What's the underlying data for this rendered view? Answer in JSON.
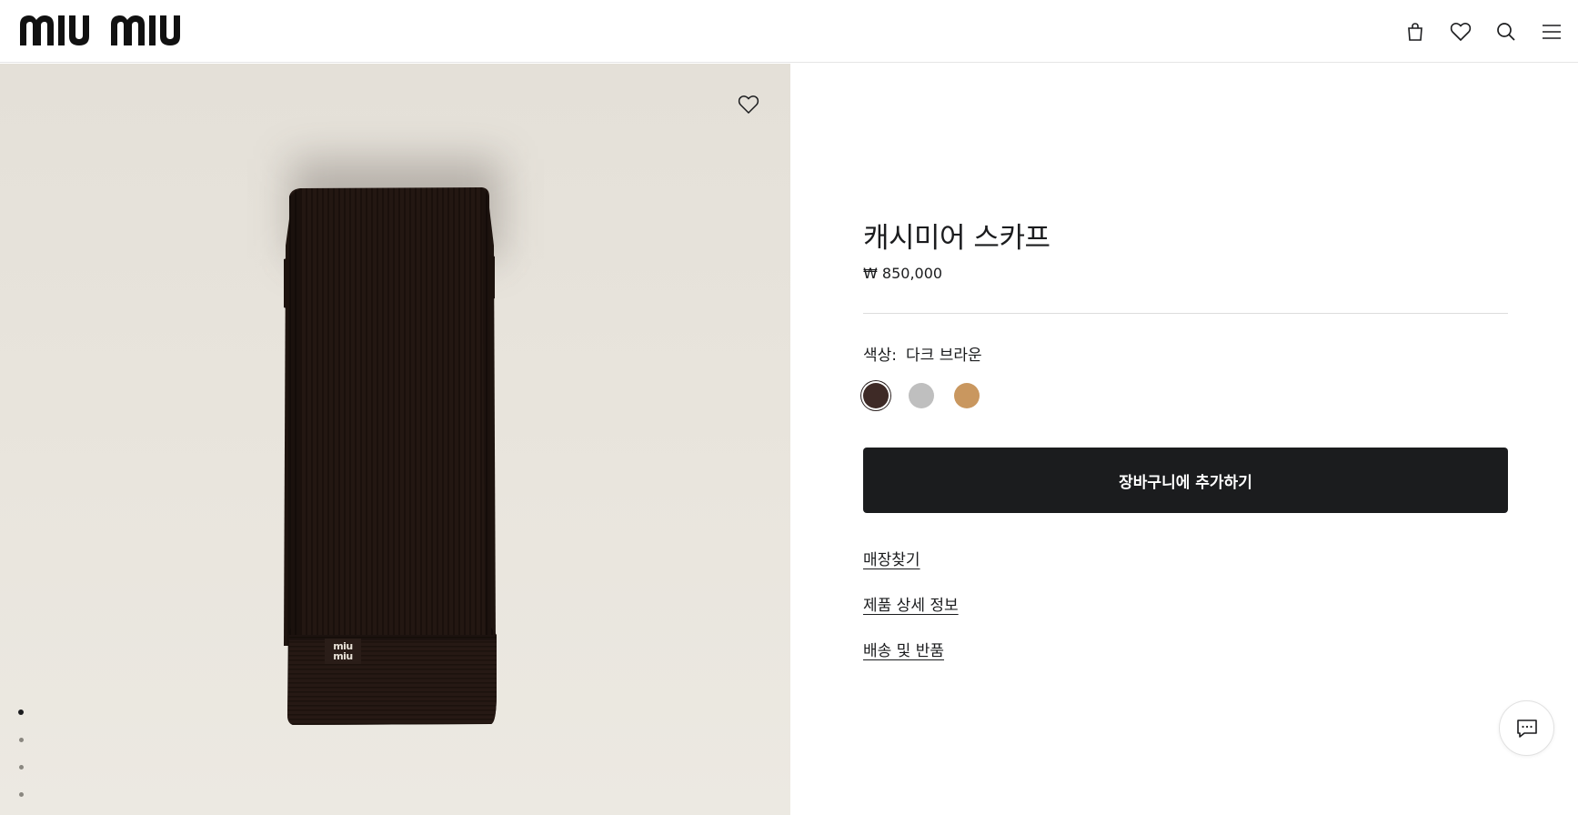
{
  "header": {
    "logo_text": "miu miu",
    "icons": [
      "bag-icon",
      "heart-icon",
      "search-icon",
      "menu-icon"
    ]
  },
  "gallery": {
    "wishlist_icon": "heart-icon",
    "dots": 4,
    "active_dot": 0,
    "product_label": "miu miu"
  },
  "product": {
    "title": "캐시미어 스카프",
    "price": "₩ 850,000",
    "color_label": "색상:",
    "color_value": "다크 브라운",
    "colors": [
      "#3e2a26",
      "#bfbfbf",
      "#c9975f"
    ],
    "selected_color": 0,
    "add_to_cart": "장바구니에 추가하기",
    "links": {
      "find_store": "매장찾기",
      "details": "제품 상세 정보",
      "shipping": "배송 및 반품"
    }
  },
  "chat": {
    "icon": "chat-icon"
  }
}
